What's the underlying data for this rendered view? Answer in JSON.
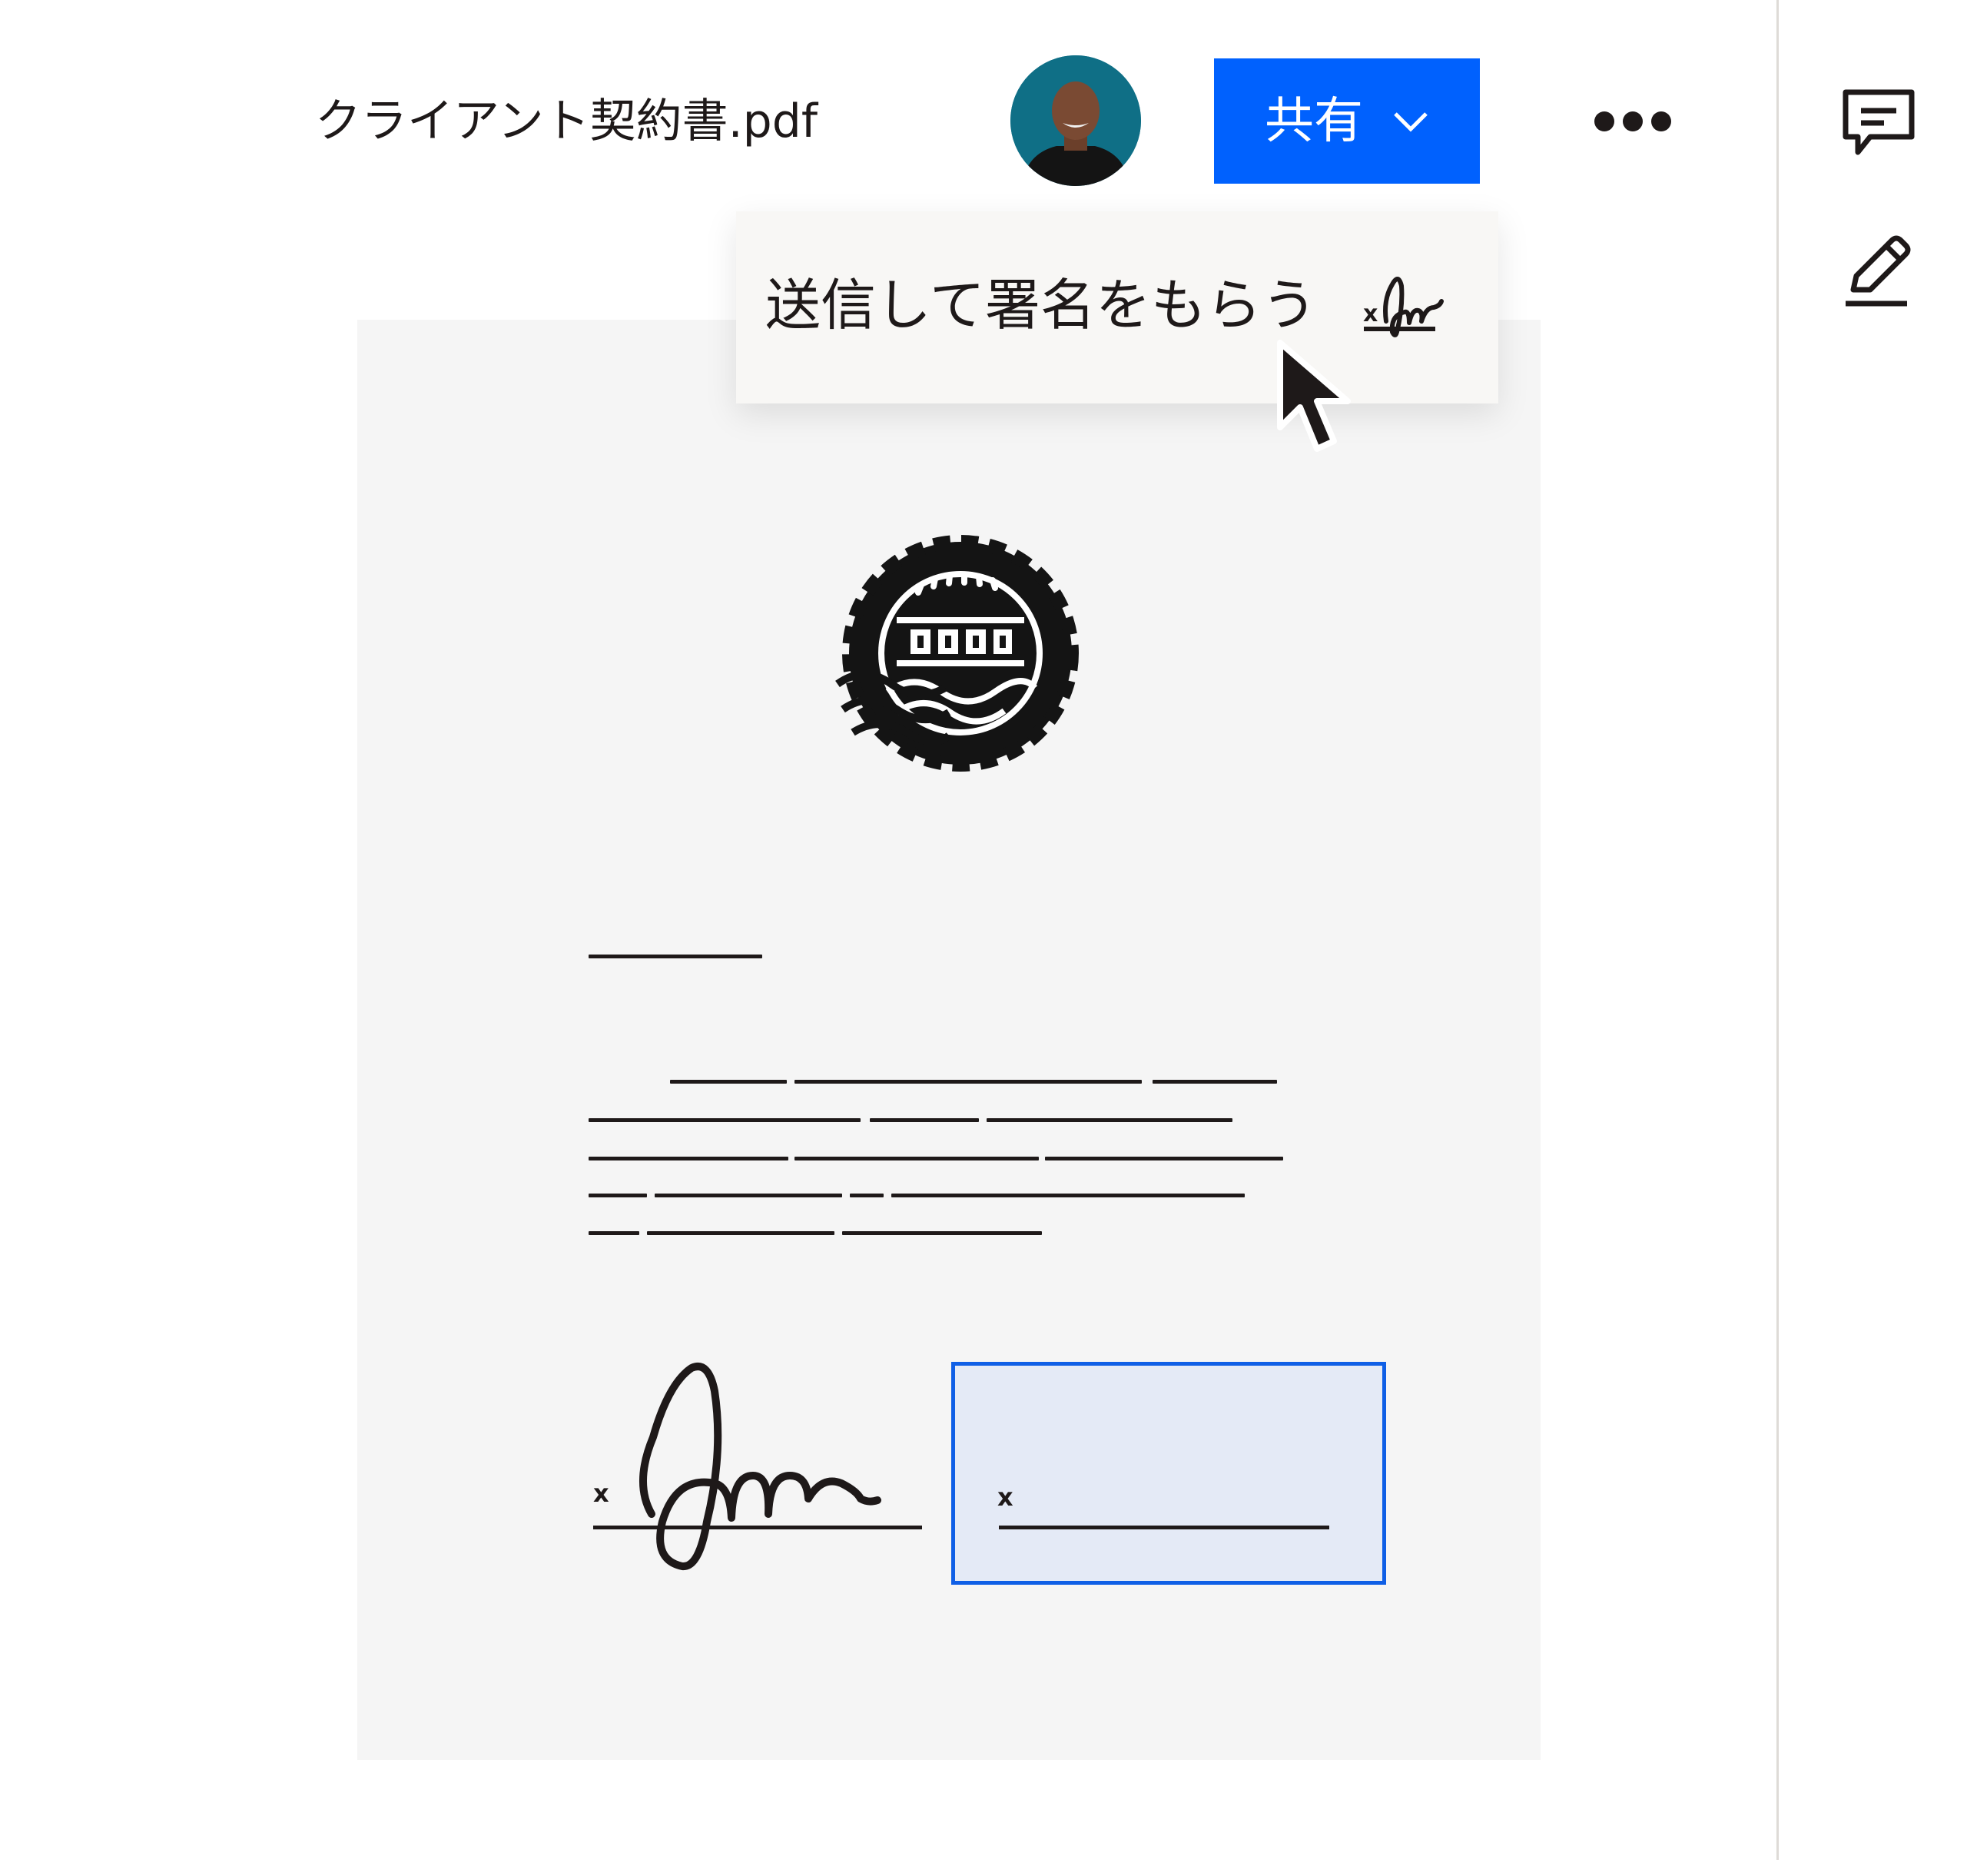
{
  "header": {
    "filename": "クライアント契約書.pdf",
    "share_label": "共有",
    "icons": {
      "avatar": "user-avatar",
      "share_dropdown": "chevron-down-icon",
      "more": "more-horizontal-icon"
    }
  },
  "dropdown": {
    "label": "送信して署名をもらう",
    "icon": "signature-icon"
  },
  "side_rail": {
    "icons": [
      "comment-icon",
      "pencil-icon"
    ]
  },
  "document": {
    "seal": "seal-stamp-icon",
    "signatures": {
      "signed_marker": "x",
      "empty_marker": "x"
    }
  },
  "colors": {
    "accent": "#0061fe",
    "field_background": "#e4eaf6",
    "field_border": "#0f5fe6",
    "document_background": "#f5f5f5",
    "text": "#1e1919"
  }
}
